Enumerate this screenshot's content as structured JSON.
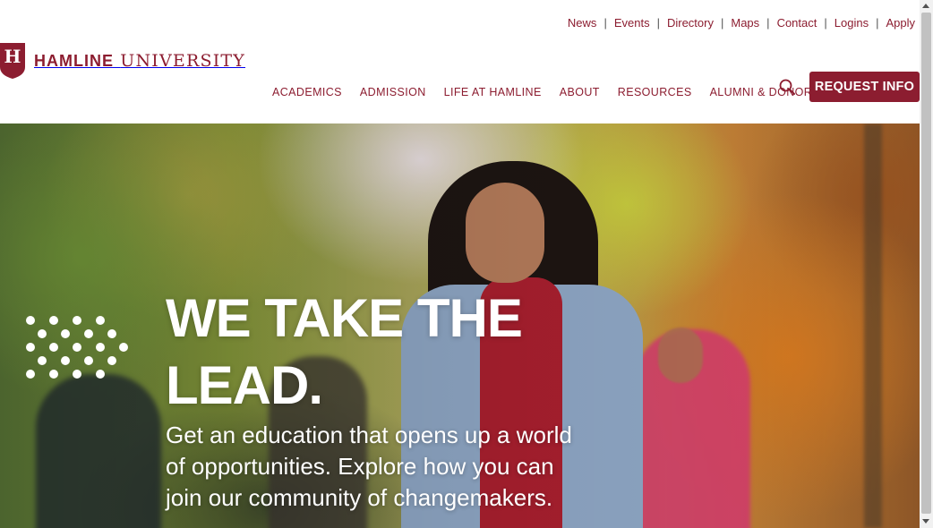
{
  "brand": {
    "logo_letter": "H",
    "name_bold": "HAMLINE",
    "name_rest": "UNIVERSITY",
    "accent_color": "#8c1d30"
  },
  "utility_nav": {
    "items": [
      "News",
      "Events",
      "Directory",
      "Maps",
      "Contact",
      "Logins",
      "Apply"
    ]
  },
  "main_nav": {
    "items": [
      "ACADEMICS",
      "ADMISSION",
      "LIFE AT HAMLINE",
      "ABOUT",
      "RESOURCES",
      "ALUMNI & DONORS"
    ],
    "search_icon": "search-icon",
    "request_info_label": "REQUEST INFO"
  },
  "hero": {
    "headline_line1": "WE TAKE THE",
    "headline_line2": "LEAD.",
    "subtext": "Get an education that opens up a world of opportunities. Explore how you can join our community of changemakers."
  }
}
